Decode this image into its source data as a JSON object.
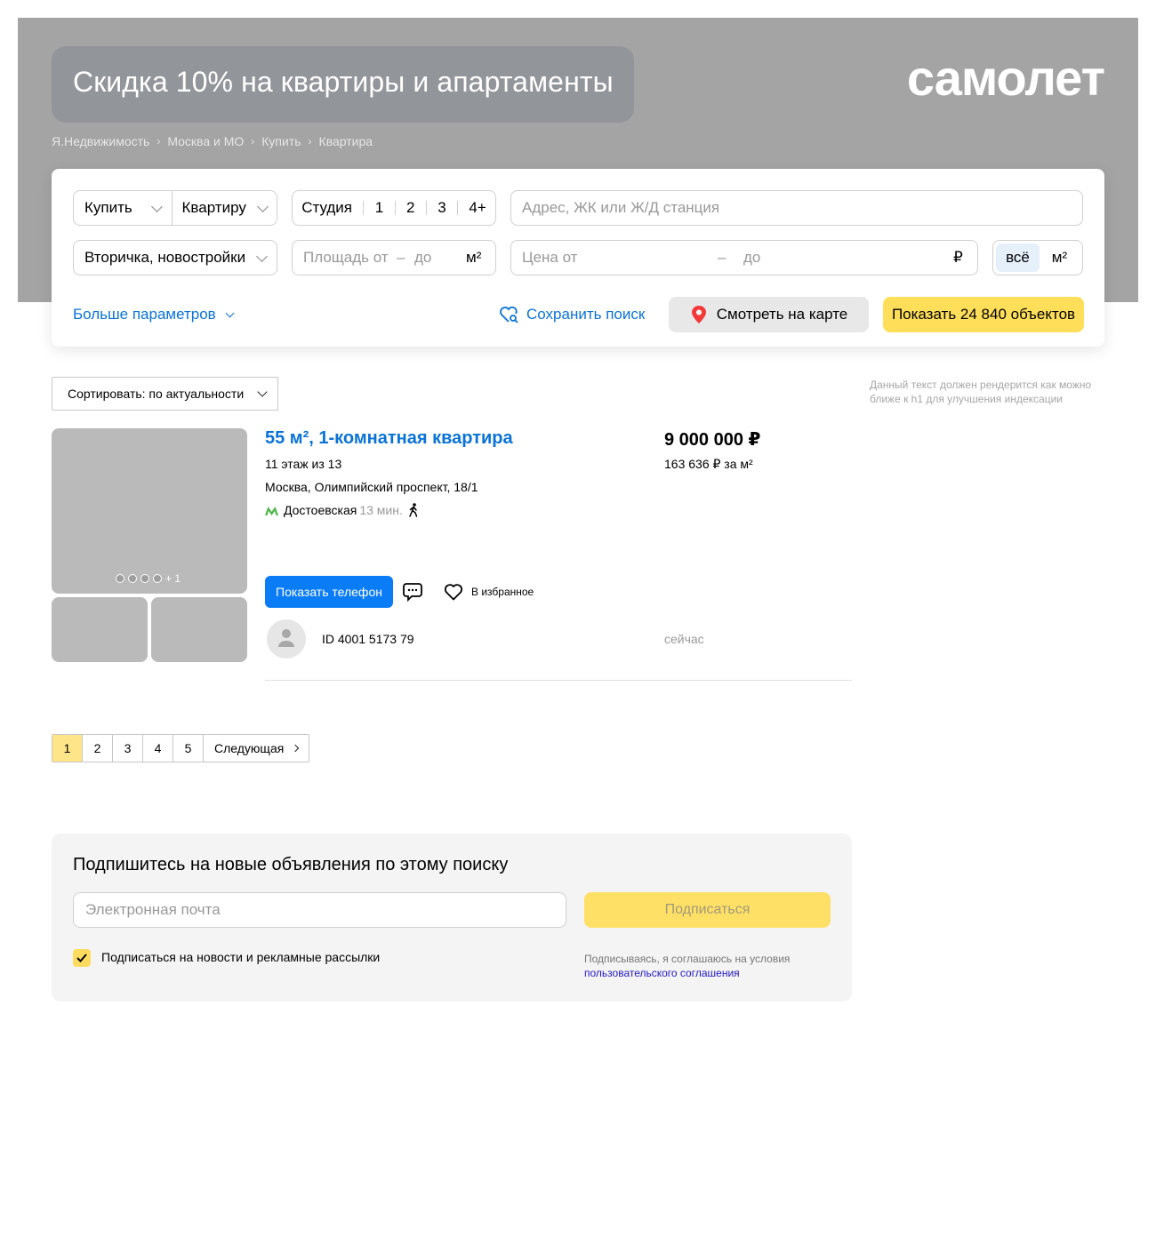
{
  "banner": {
    "promo": "Скидка 10% на квартиры и апартаменты",
    "logo": "самолет"
  },
  "breadcrumbs": [
    "Я.Недвижимость",
    "Москва и МО",
    "Купить",
    "Квартира"
  ],
  "filters": {
    "deal_type": "Купить",
    "property_type": "Квартиру",
    "rooms": [
      "Студия",
      "1",
      "2",
      "3",
      "4+"
    ],
    "address_placeholder": "Адрес, ЖК или Ж/Д станция",
    "market": "Вторичка, новостройки",
    "area_from_placeholder": "Площадь от",
    "area_dash": "–",
    "area_to_placeholder": "до",
    "area_unit": "м²",
    "price_from_placeholder": "Цена от",
    "price_dash": "–",
    "price_to_placeholder": "до",
    "price_unit": "₽",
    "price_mode_all": "всё",
    "price_mode_sqm": "м²",
    "more_params": "Больше параметров",
    "save_search": "Сохранить поиск",
    "show_on_map": "Смотреть на карте",
    "show_results": "Показать 24 840 объектов"
  },
  "sort": {
    "label": "Сортировать: по актуальности"
  },
  "seo_note": "Данный текст должен рендерится как можно ближе к h1 для улучшения индексации",
  "offer": {
    "photo_more": "+ 1",
    "title": "55 м², 1-комнатная квартира",
    "floor": "11 этаж из 13",
    "address": "Москва, Олимпийский проспект, 18/1",
    "metro": "Достоевская",
    "metro_time": "13 мин.",
    "price": "9 000 000 ₽",
    "price_per_meter": "163 636 ₽ за м²",
    "show_phone": "Показать телефон",
    "favorite": "В избранное",
    "seller_id": "ID 4001 5173 79",
    "updated": "сейчас"
  },
  "pagination": {
    "pages": [
      "1",
      "2",
      "3",
      "4",
      "5"
    ],
    "next": "Следующая"
  },
  "subscribe": {
    "title": "Подпишитесь на новые объявления по этому поиску",
    "email_placeholder": "Электронная почта",
    "button": "Подписаться",
    "news_checkbox": "Подписаться на новости и рекламные рассылки",
    "terms_text": "Подписываясь, я соглашаюсь на условия",
    "terms_link": "пользовательского соглашения"
  },
  "colors": {
    "accent_blue": "#0a73d6",
    "button_blue": "#0a7cf5",
    "yellow": "#ffdf5a",
    "metro_green": "#4cb848",
    "map_pin_red": "#f23a3a"
  }
}
